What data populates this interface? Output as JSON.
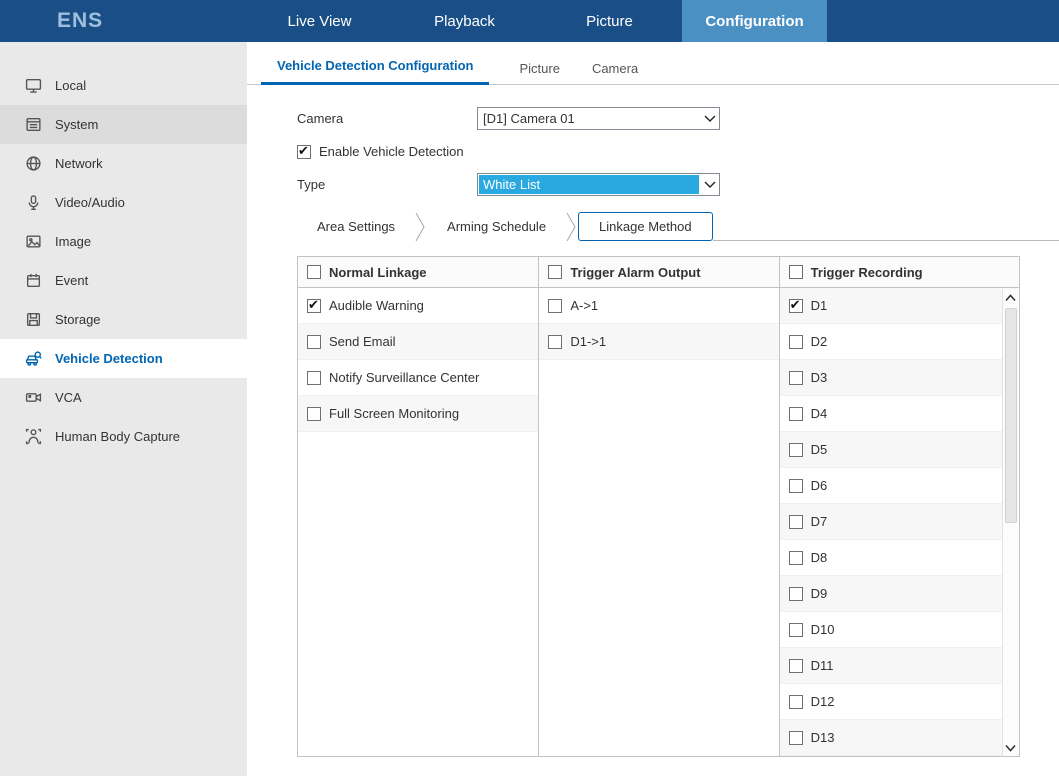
{
  "topbar": {
    "brand": "ENS",
    "nav": [
      {
        "label": "Live View"
      },
      {
        "label": "Playback"
      },
      {
        "label": "Picture"
      },
      {
        "label": "Configuration"
      }
    ]
  },
  "sidebar": {
    "items": [
      {
        "label": "Local"
      },
      {
        "label": "System"
      },
      {
        "label": "Network"
      },
      {
        "label": "Video/Audio"
      },
      {
        "label": "Image"
      },
      {
        "label": "Event"
      },
      {
        "label": "Storage"
      },
      {
        "label": "Vehicle Detection"
      },
      {
        "label": "VCA"
      },
      {
        "label": "Human Body Capture"
      }
    ]
  },
  "main": {
    "tabs": [
      {
        "label": "Vehicle Detection Configuration"
      },
      {
        "label": "Picture"
      },
      {
        "label": "Camera"
      }
    ],
    "form": {
      "camera_label": "Camera",
      "camera_value": "[D1] Camera 01",
      "enable_label": "Enable Vehicle Detection",
      "enable_checked": true,
      "type_label": "Type",
      "type_value": "White List"
    },
    "subtabs": [
      {
        "label": "Area Settings"
      },
      {
        "label": "Arming Schedule"
      },
      {
        "label": "Linkage Method"
      }
    ],
    "linkage_table": {
      "columns": [
        {
          "header": "Normal Linkage",
          "header_checked": false,
          "items": [
            {
              "label": "Audible Warning",
              "checked": true
            },
            {
              "label": "Send Email",
              "checked": false
            },
            {
              "label": "Notify Surveillance Center",
              "checked": false
            },
            {
              "label": "Full Screen Monitoring",
              "checked": false
            }
          ]
        },
        {
          "header": "Trigger Alarm Output",
          "header_checked": false,
          "items": [
            {
              "label": "A->1",
              "checked": false
            },
            {
              "label": "D1->1",
              "checked": false
            }
          ]
        },
        {
          "header": "Trigger Recording",
          "header_checked": false,
          "items": [
            {
              "label": "D1",
              "checked": true
            },
            {
              "label": "D2",
              "checked": false
            },
            {
              "label": "D3",
              "checked": false
            },
            {
              "label": "D4",
              "checked": false
            },
            {
              "label": "D5",
              "checked": false
            },
            {
              "label": "D6",
              "checked": false
            },
            {
              "label": "D7",
              "checked": false
            },
            {
              "label": "D8",
              "checked": false
            },
            {
              "label": "D9",
              "checked": false
            },
            {
              "label": "D10",
              "checked": false
            },
            {
              "label": "D11",
              "checked": false
            },
            {
              "label": "D12",
              "checked": false
            },
            {
              "label": "D13",
              "checked": false
            }
          ]
        }
      ]
    }
  },
  "colors": {
    "topbar_bg": "#1a4e86",
    "nav_active_bg": "#4a90c2",
    "accent": "#0065b3",
    "selection_bg": "#29a9e0"
  }
}
